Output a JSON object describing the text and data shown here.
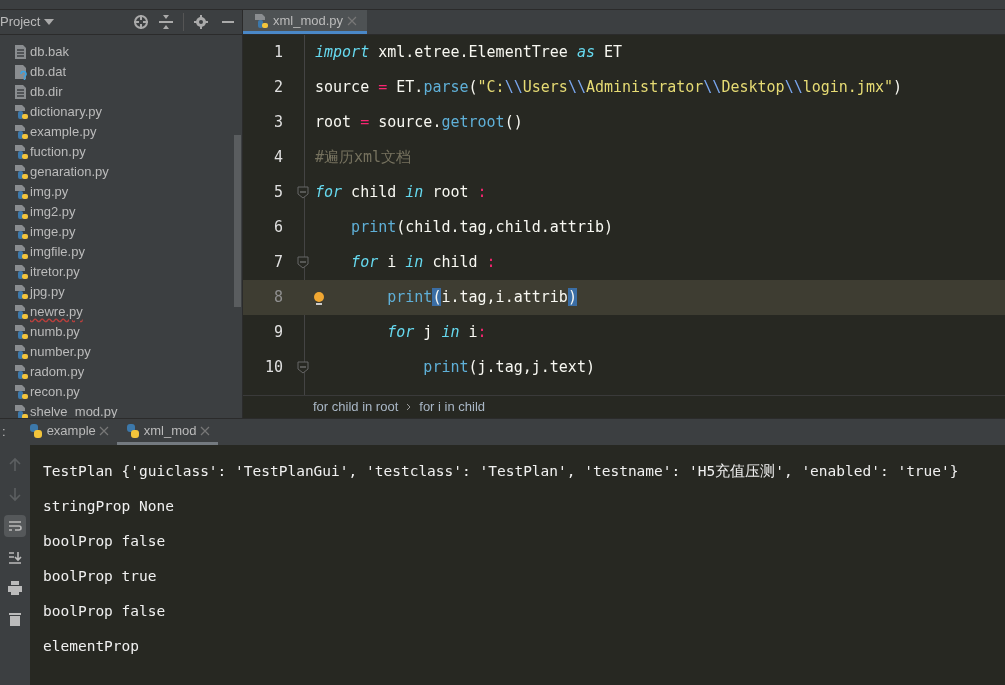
{
  "project_panel": {
    "title": "Project",
    "files": [
      {
        "name": "db.bak",
        "kind": "text",
        "error": false
      },
      {
        "name": "db.dat",
        "kind": "unknown",
        "error": false
      },
      {
        "name": "db.dir",
        "kind": "text",
        "error": false
      },
      {
        "name": "dictionary.py",
        "kind": "python",
        "error": false
      },
      {
        "name": "example.py",
        "kind": "python",
        "error": false
      },
      {
        "name": "fuction.py",
        "kind": "python",
        "error": false
      },
      {
        "name": "genaration.py",
        "kind": "python",
        "error": false
      },
      {
        "name": "img.py",
        "kind": "python",
        "error": false
      },
      {
        "name": "img2.py",
        "kind": "python",
        "error": false
      },
      {
        "name": "imge.py",
        "kind": "python",
        "error": false
      },
      {
        "name": "imgfile.py",
        "kind": "python",
        "error": false
      },
      {
        "name": "itretor.py",
        "kind": "python",
        "error": false
      },
      {
        "name": "jpg.py",
        "kind": "python",
        "error": false
      },
      {
        "name": "newre.py",
        "kind": "python",
        "error": true
      },
      {
        "name": "numb.py",
        "kind": "python",
        "error": false
      },
      {
        "name": "number.py",
        "kind": "python",
        "error": false
      },
      {
        "name": "radom.py",
        "kind": "python",
        "error": false
      },
      {
        "name": "recon.py",
        "kind": "python",
        "error": false
      },
      {
        "name": "shelve_mod.py",
        "kind": "python",
        "error": false
      }
    ]
  },
  "editor": {
    "tabs": [
      {
        "label": "xml_mod.py",
        "selected": true
      }
    ],
    "lines": [
      {
        "number": "1",
        "current": false,
        "fold": false,
        "bulb": false,
        "tokens": [
          {
            "kind": "keyword",
            "text": "import"
          },
          {
            "kind": "plain",
            "text": " xml.etree.ElementTree "
          },
          {
            "kind": "keyword",
            "text": "as"
          },
          {
            "kind": "plain",
            "text": " ET"
          }
        ]
      },
      {
        "number": "2",
        "current": false,
        "fold": false,
        "bulb": false,
        "tokens": [
          {
            "kind": "plain",
            "text": "source "
          },
          {
            "kind": "operator",
            "text": "="
          },
          {
            "kind": "plain",
            "text": " ET."
          },
          {
            "kind": "call",
            "text": "parse"
          },
          {
            "kind": "plain",
            "text": "("
          },
          {
            "kind": "string",
            "text": "\"C:"
          },
          {
            "kind": "escape",
            "text": "\\\\"
          },
          {
            "kind": "string",
            "text": "Users"
          },
          {
            "kind": "escape",
            "text": "\\\\"
          },
          {
            "kind": "string",
            "text": "Administrator"
          },
          {
            "kind": "escape",
            "text": "\\\\"
          },
          {
            "kind": "string",
            "text": "Desktop"
          },
          {
            "kind": "escape",
            "text": "\\\\"
          },
          {
            "kind": "string",
            "text": "login.jmx\""
          },
          {
            "kind": "plain",
            "text": ")"
          }
        ]
      },
      {
        "number": "3",
        "current": false,
        "fold": false,
        "bulb": false,
        "tokens": [
          {
            "kind": "plain",
            "text": "root "
          },
          {
            "kind": "operator",
            "text": "="
          },
          {
            "kind": "plain",
            "text": " source."
          },
          {
            "kind": "call",
            "text": "getroot"
          },
          {
            "kind": "plain",
            "text": "()"
          }
        ]
      },
      {
        "number": "4",
        "current": false,
        "fold": false,
        "bulb": false,
        "tokens": [
          {
            "kind": "comment",
            "text": "#遍历xml文档"
          }
        ]
      },
      {
        "number": "5",
        "current": false,
        "fold": true,
        "bulb": false,
        "tokens": [
          {
            "kind": "keyword",
            "text": "for"
          },
          {
            "kind": "plain",
            "text": " child "
          },
          {
            "kind": "keyword",
            "text": "in"
          },
          {
            "kind": "plain",
            "text": " root "
          },
          {
            "kind": "operator",
            "text": ":"
          }
        ]
      },
      {
        "number": "6",
        "current": false,
        "fold": false,
        "bulb": false,
        "tokens": [
          {
            "kind": "call",
            "text": "    print"
          },
          {
            "kind": "plain",
            "text": "(child.tag,child.attrib)"
          }
        ]
      },
      {
        "number": "7",
        "current": false,
        "fold": true,
        "bulb": false,
        "tokens": [
          {
            "kind": "keyword",
            "text": "    for"
          },
          {
            "kind": "plain",
            "text": " i "
          },
          {
            "kind": "keyword",
            "text": "in"
          },
          {
            "kind": "plain",
            "text": " child "
          },
          {
            "kind": "operator",
            "text": ":"
          }
        ]
      },
      {
        "number": "8",
        "current": true,
        "fold": false,
        "bulb": true,
        "tokens": [
          {
            "kind": "call",
            "text": "        print"
          },
          {
            "kind": "match",
            "text": "("
          },
          {
            "kind": "plain",
            "text": "i.tag,i.attrib"
          },
          {
            "kind": "match",
            "text": ")"
          }
        ]
      },
      {
        "number": "9",
        "current": false,
        "fold": false,
        "bulb": false,
        "tokens": [
          {
            "kind": "keyword",
            "text": "        for"
          },
          {
            "kind": "plain",
            "text": " j "
          },
          {
            "kind": "keyword",
            "text": "in"
          },
          {
            "kind": "plain",
            "text": " i"
          },
          {
            "kind": "operator",
            "text": ":"
          }
        ]
      },
      {
        "number": "10",
        "current": false,
        "fold": true,
        "bulb": false,
        "tokens": [
          {
            "kind": "call",
            "text": "            print"
          },
          {
            "kind": "plain",
            "text": "(j.tag,j.text)"
          }
        ]
      }
    ],
    "breadcrumbs": [
      "for child in root",
      "for i in child"
    ]
  },
  "run_panel": {
    "prefix": ":",
    "tabs": [
      {
        "label": "example",
        "selected": false
      },
      {
        "label": "xml_mod",
        "selected": true
      }
    ],
    "tools": [
      {
        "kind": "up",
        "active": false
      },
      {
        "kind": "down",
        "active": false
      },
      {
        "kind": "wrap",
        "active": true
      },
      {
        "kind": "scroll-end",
        "active": false
      },
      {
        "kind": "print",
        "active": false
      },
      {
        "kind": "trash",
        "active": false
      }
    ],
    "output": [
      "TestPlan {'guiclass': 'TestPlanGui', 'testclass': 'TestPlan', 'testname': 'H5充值压测', 'enabled': 'true'}",
      "stringProp None",
      "boolProp false",
      "boolProp true",
      "boolProp false",
      "elementProp"
    ]
  }
}
